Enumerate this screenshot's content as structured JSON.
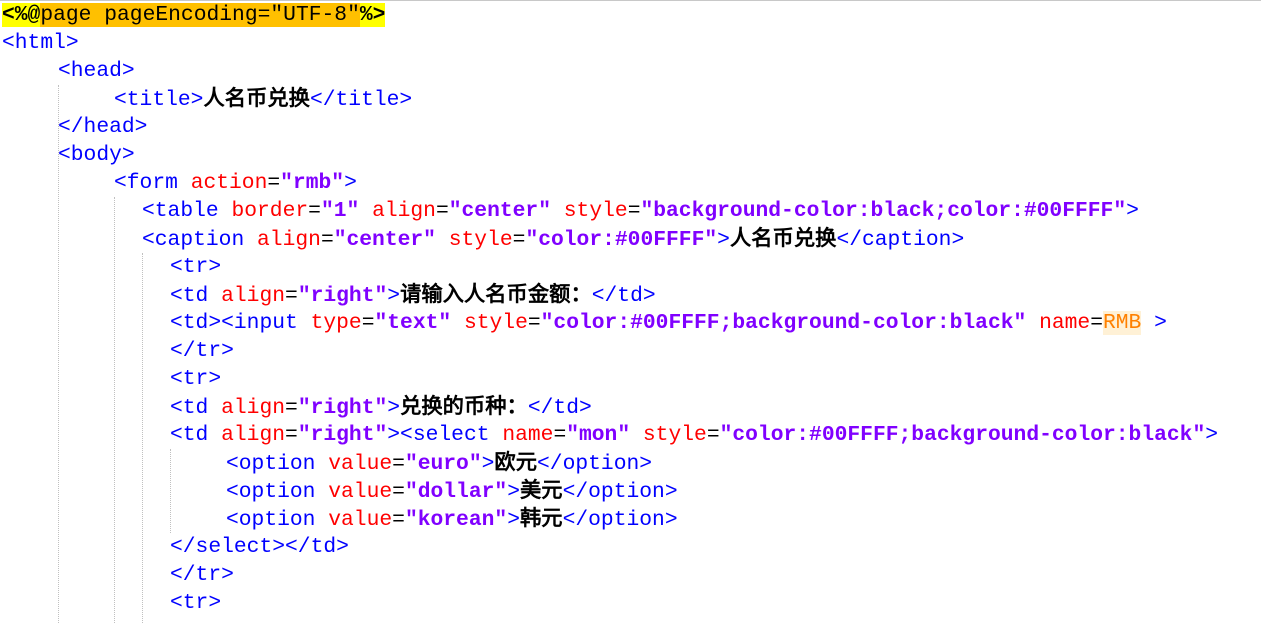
{
  "editor": {
    "lines": [
      {
        "indent": 0,
        "tokens": [
          [
            "dir",
            "<%@"
          ],
          [
            "dirb",
            "page pageEncoding=\"UTF-8\""
          ],
          [
            "dir",
            "%>"
          ]
        ]
      },
      {
        "indent": 0,
        "tokens": [
          [
            "t",
            "<html>"
          ]
        ]
      },
      {
        "indent": 2,
        "tokens": [
          [
            "t",
            "<head>"
          ]
        ]
      },
      {
        "indent": 4,
        "tokens": [
          [
            "t",
            "<title>"
          ],
          [
            "tx",
            "人名币兑换"
          ],
          [
            "t",
            "</title>"
          ]
        ]
      },
      {
        "indent": 2,
        "tokens": [
          [
            "t",
            "</head>"
          ]
        ]
      },
      {
        "indent": 2,
        "tokens": [
          [
            "t",
            "<body>"
          ]
        ]
      },
      {
        "indent": 4,
        "tokens": [
          [
            "t",
            "<form "
          ],
          [
            "a",
            "action"
          ],
          [
            "p",
            "="
          ],
          [
            "s",
            "\"rmb\""
          ],
          [
            "t",
            ">"
          ]
        ]
      },
      {
        "indent": 5,
        "tokens": [
          [
            "t",
            "<table "
          ],
          [
            "a",
            "border"
          ],
          [
            "p",
            "="
          ],
          [
            "s",
            "\"1\""
          ],
          [
            "p",
            " "
          ],
          [
            "a",
            "align"
          ],
          [
            "p",
            "="
          ],
          [
            "s",
            "\"center\""
          ],
          [
            "p",
            " "
          ],
          [
            "a",
            "style"
          ],
          [
            "p",
            "="
          ],
          [
            "s",
            "\"background-color:black;color:#00FFFF\""
          ],
          [
            "t",
            ">"
          ]
        ]
      },
      {
        "indent": 5,
        "tokens": [
          [
            "t",
            "<caption "
          ],
          [
            "a",
            "align"
          ],
          [
            "p",
            "="
          ],
          [
            "s",
            "\"center\""
          ],
          [
            "p",
            " "
          ],
          [
            "a",
            "style"
          ],
          [
            "p",
            "="
          ],
          [
            "s",
            "\"color:#00FFFF\""
          ],
          [
            "t",
            ">"
          ],
          [
            "tx",
            "人名币兑换"
          ],
          [
            "t",
            "</caption>"
          ]
        ]
      },
      {
        "indent": 6,
        "tokens": [
          [
            "t",
            "<tr>"
          ]
        ]
      },
      {
        "indent": 6,
        "tokens": [
          [
            "t",
            "<td "
          ],
          [
            "a",
            "align"
          ],
          [
            "p",
            "="
          ],
          [
            "s",
            "\"right\""
          ],
          [
            "t",
            ">"
          ],
          [
            "tx",
            "请输入人名币金额："
          ],
          [
            "t",
            "</td>"
          ]
        ]
      },
      {
        "indent": 6,
        "tokens": [
          [
            "t",
            "<td><input "
          ],
          [
            "a",
            "type"
          ],
          [
            "p",
            "="
          ],
          [
            "s",
            "\"text\""
          ],
          [
            "p",
            " "
          ],
          [
            "a",
            "style"
          ],
          [
            "p",
            "="
          ],
          [
            "s",
            "\"color:#00FFFF;background-color:black\""
          ],
          [
            "p",
            " "
          ],
          [
            "a",
            "name"
          ],
          [
            "p",
            "="
          ],
          [
            "un",
            "RMB"
          ],
          [
            "p",
            " "
          ],
          [
            "t",
            ">"
          ]
        ]
      },
      {
        "indent": 6,
        "tokens": [
          [
            "t",
            "</tr>"
          ]
        ]
      },
      {
        "indent": 6,
        "tokens": [
          [
            "t",
            "<tr>"
          ]
        ]
      },
      {
        "indent": 6,
        "tokens": [
          [
            "t",
            "<td "
          ],
          [
            "a",
            "align"
          ],
          [
            "p",
            "="
          ],
          [
            "s",
            "\"right\""
          ],
          [
            "t",
            ">"
          ],
          [
            "tx",
            "兑换的币种："
          ],
          [
            "t",
            "</td>"
          ]
        ]
      },
      {
        "indent": 6,
        "tokens": [
          [
            "t",
            "<td "
          ],
          [
            "a",
            "align"
          ],
          [
            "p",
            "="
          ],
          [
            "s",
            "\"right\""
          ],
          [
            "t",
            "><select "
          ],
          [
            "a",
            "name"
          ],
          [
            "p",
            "="
          ],
          [
            "s",
            "\"mon\""
          ],
          [
            "p",
            " "
          ],
          [
            "a",
            "style"
          ],
          [
            "p",
            "="
          ],
          [
            "s",
            "\"color:#00FFFF;background-color:black\""
          ],
          [
            "t",
            ">"
          ]
        ]
      },
      {
        "indent": 8,
        "tokens": [
          [
            "t",
            "<option "
          ],
          [
            "a",
            "value"
          ],
          [
            "p",
            "="
          ],
          [
            "s",
            "\"euro\""
          ],
          [
            "t",
            ">"
          ],
          [
            "tx",
            "欧元"
          ],
          [
            "t",
            "</option>"
          ]
        ]
      },
      {
        "indent": 8,
        "tokens": [
          [
            "t",
            "<option "
          ],
          [
            "a",
            "value"
          ],
          [
            "p",
            "="
          ],
          [
            "s",
            "\"dollar\""
          ],
          [
            "t",
            ">"
          ],
          [
            "tx",
            "美元"
          ],
          [
            "t",
            "</option>"
          ]
        ]
      },
      {
        "indent": 8,
        "tokens": [
          [
            "t",
            "<option "
          ],
          [
            "a",
            "value"
          ],
          [
            "p",
            "="
          ],
          [
            "s",
            "\"korean\""
          ],
          [
            "t",
            ">"
          ],
          [
            "tx",
            "韩元"
          ],
          [
            "t",
            "</option>"
          ]
        ]
      },
      {
        "indent": 6,
        "tokens": [
          [
            "t",
            "</select></td>"
          ]
        ]
      },
      {
        "indent": 6,
        "tokens": [
          [
            "t",
            "</tr>"
          ]
        ]
      },
      {
        "indent": 6,
        "tokens": [
          [
            "t",
            "<tr>"
          ]
        ]
      }
    ]
  }
}
